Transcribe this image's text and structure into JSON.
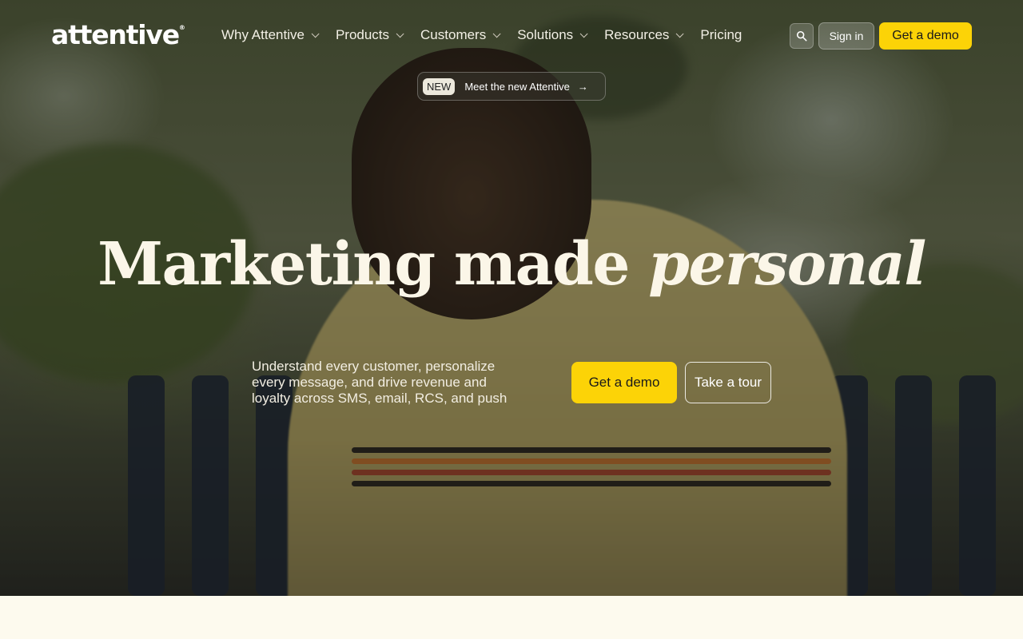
{
  "nav": {
    "logo": "attentive",
    "logo_mark": "®",
    "items": [
      {
        "label": "Why Attentive",
        "has_dropdown": true
      },
      {
        "label": "Products",
        "has_dropdown": true
      },
      {
        "label": "Customers",
        "has_dropdown": true
      },
      {
        "label": "Solutions",
        "has_dropdown": true
      },
      {
        "label": "Resources",
        "has_dropdown": true
      },
      {
        "label": "Pricing",
        "has_dropdown": false
      }
    ],
    "search_icon": "search-icon",
    "signin_label": "Sign in",
    "demo_label": "Get a demo"
  },
  "announcement": {
    "badge": "NEW",
    "text": "Meet the new Attentive",
    "arrow": "→"
  },
  "hero": {
    "headline_main": "Marketing made ",
    "headline_italic": "personal",
    "subtext": "Understand every customer, personalize every message, and drive revenue and loyalty across SMS, email, RCS, and push",
    "primary_cta": "Get a demo",
    "secondary_cta": "Take a tour"
  },
  "colors": {
    "accent": "#fcd307",
    "cream": "#fdfaee"
  }
}
